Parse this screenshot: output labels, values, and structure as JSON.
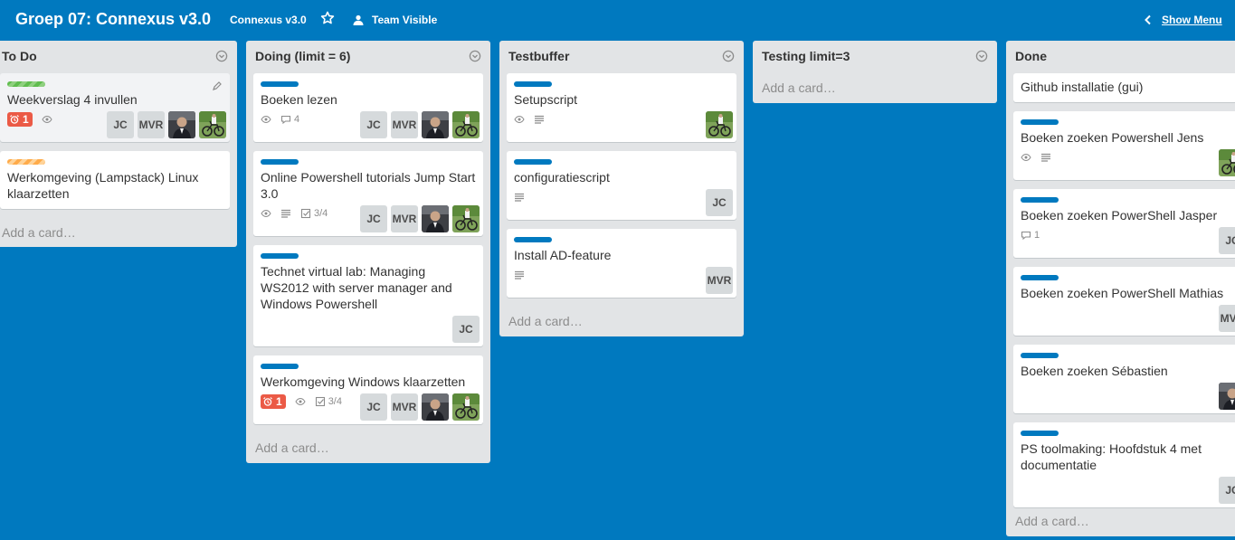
{
  "header": {
    "board_title": "Groep 07: Connexus v3.0",
    "org_name": "Connexus v3.0",
    "visibility": "Team Visible",
    "show_menu": "Show Menu",
    "icons": [
      "star-icon",
      "team-icon",
      "chevron-left-icon"
    ]
  },
  "colors": {
    "board_background": "#0079bf",
    "list_background": "#e2e4e6",
    "label_blue": "#0079bf",
    "label_green": "#61bd4f",
    "label_orange": "#ffab4a",
    "due_badge_red": "#eb5a46"
  },
  "add_card_label": "Add a card…",
  "lists": [
    {
      "title": "To Do",
      "cards": [
        {
          "label": "green",
          "title": "Weekverslag 4 invullen",
          "due": "1",
          "watch": true,
          "members": [
            "JC",
            "MVR",
            "photo-man",
            "photo-cyclist"
          ]
        },
        {
          "label": "orange",
          "title": "Werkomgeving (Lampstack) Linux klaarzetten",
          "members": []
        }
      ]
    },
    {
      "title": "Doing (limit = 6)",
      "cards": [
        {
          "label": "blue",
          "title": "Boeken lezen",
          "watch": true,
          "comments": "4",
          "members": [
            "JC",
            "MVR",
            "photo-man",
            "photo-cyclist"
          ]
        },
        {
          "label": "blue",
          "title": "Online Powershell tutorials Jump Start 3.0",
          "watch": true,
          "description": true,
          "checklist": "3/4",
          "members": [
            "JC",
            "MVR",
            "photo-man",
            "photo-cyclist"
          ]
        },
        {
          "label": "blue",
          "title": "Technet virtual lab: Managing WS2012 with server manager and Windows Powershell",
          "members": [
            "JC"
          ]
        },
        {
          "label": "blue",
          "title": "Werkomgeving Windows klaarzetten",
          "due": "1",
          "watch": true,
          "checklist": "3/4",
          "members": [
            "JC",
            "MVR",
            "photo-man",
            "photo-cyclist"
          ]
        }
      ]
    },
    {
      "title": "Testbuffer",
      "cards": [
        {
          "label": "blue",
          "title": "Setupscript",
          "watch": true,
          "description": true,
          "members": [
            "photo-cyclist"
          ]
        },
        {
          "label": "blue",
          "title": "configuratiescript",
          "description": true,
          "members": [
            "JC"
          ]
        },
        {
          "label": "blue",
          "title": "Install AD-feature",
          "description": true,
          "members": [
            "MVR"
          ]
        }
      ]
    },
    {
      "title": "Testing limit=3",
      "cards": []
    },
    {
      "title": "Done",
      "cards": [
        {
          "title": "Github installatie (gui)",
          "members": []
        },
        {
          "label": "blue",
          "title": "Boeken zoeken Powershell Jens",
          "watch": true,
          "description": true,
          "members": [
            "photo-cyclist"
          ]
        },
        {
          "label": "blue",
          "title": "Boeken zoeken PowerShell Jasper",
          "comments": "1",
          "members": [
            "JC"
          ]
        },
        {
          "label": "blue",
          "title": "Boeken zoeken PowerShell Mathias",
          "members": [
            "MVR"
          ]
        },
        {
          "label": "blue",
          "title": "Boeken zoeken Sébastien",
          "members": [
            "photo-man"
          ]
        },
        {
          "label": "blue",
          "title": "PS toolmaking: Hoofdstuk 4 met documentatie",
          "members": [
            "JC"
          ]
        }
      ]
    }
  ]
}
